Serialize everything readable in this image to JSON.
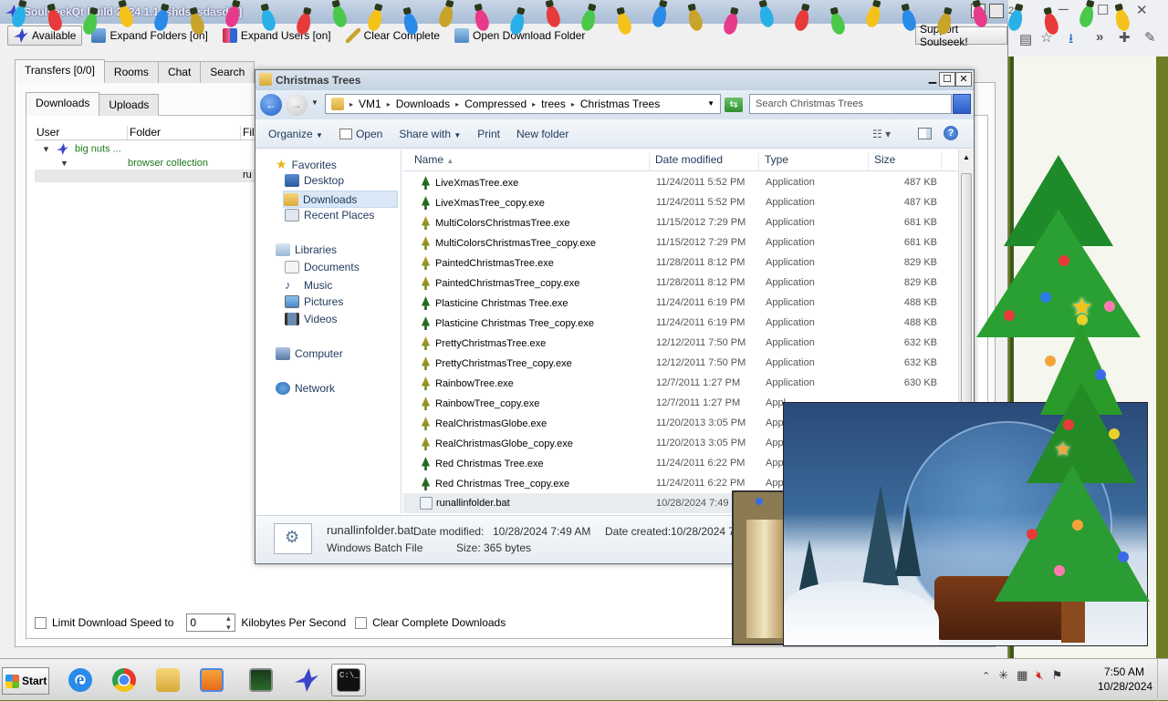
{
  "soulseek": {
    "title": "SoulseekQt build 2024.1.1 [shdsasdasdfs]",
    "toolbar": {
      "status": "Available",
      "expand_folders": "Expand Folders [on]",
      "expand_users": "Expand Users [on]",
      "clear_complete": "Clear Complete",
      "open_download_folder": "Open Download Folder",
      "support": "Support Soulseek!"
    },
    "tabs": [
      {
        "label": "Transfers [0/0]"
      },
      {
        "label": "Rooms"
      },
      {
        "label": "Chat"
      },
      {
        "label": "Search"
      }
    ],
    "subtabs": [
      {
        "label": "Downloads"
      },
      {
        "label": "Uploads"
      }
    ],
    "columns": {
      "user": "User",
      "folder": "Folder",
      "file": "Fil"
    },
    "tree": {
      "user": "big nuts ...",
      "folder": "browser collection",
      "file": "ru"
    },
    "bottom": {
      "limit_label": "Limit Download Speed to",
      "limit_value": "0",
      "unit": "Kilobytes Per Second",
      "clear_complete_downloads": "Clear Complete Downloads"
    }
  },
  "explorer": {
    "title": "Christmas Trees",
    "breadcrumb": [
      "VM1",
      "Downloads",
      "Compressed",
      "trees",
      "Christmas Trees"
    ],
    "search_placeholder": "Search Christmas Trees",
    "commands": {
      "organize": "Organize",
      "open": "Open",
      "share_with": "Share with",
      "print": "Print",
      "new_folder": "New folder"
    },
    "nav": {
      "favorites": "Favorites",
      "desktop": "Desktop",
      "downloads": "Downloads",
      "recent_places": "Recent Places",
      "libraries": "Libraries",
      "documents": "Documents",
      "music": "Music",
      "pictures": "Pictures",
      "videos": "Videos",
      "computer": "Computer",
      "network": "Network"
    },
    "columns": {
      "name": "Name",
      "date": "Date modified",
      "type": "Type",
      "size": "Size"
    },
    "files": [
      {
        "name": "LiveXmasTree.exe",
        "date": "11/24/2011 5:52 PM",
        "type": "Application",
        "size": "487 KB",
        "icon": "green-tree-icon"
      },
      {
        "name": "LiveXmasTree_copy.exe",
        "date": "11/24/2011 5:52 PM",
        "type": "Application",
        "size": "487 KB",
        "icon": "green-tree-icon"
      },
      {
        "name": "MultiColorsChristmasTree.exe",
        "date": "11/15/2012 7:29 PM",
        "type": "Application",
        "size": "681 KB",
        "icon": "gold-tree-icon"
      },
      {
        "name": "MultiColorsChristmasTree_copy.exe",
        "date": "11/15/2012 7:29 PM",
        "type": "Application",
        "size": "681 KB",
        "icon": "gold-tree-icon"
      },
      {
        "name": "PaintedChristmasTree.exe",
        "date": "11/28/2011 8:12 PM",
        "type": "Application",
        "size": "829 KB",
        "icon": "gold-tree-icon"
      },
      {
        "name": "PaintedChristmasTree_copy.exe",
        "date": "11/28/2011 8:12 PM",
        "type": "Application",
        "size": "829 KB",
        "icon": "gold-tree-icon"
      },
      {
        "name": "Plasticine Christmas Tree.exe",
        "date": "11/24/2011 6:19 PM",
        "type": "Application",
        "size": "488 KB",
        "icon": "green-tree-icon"
      },
      {
        "name": "Plasticine Christmas Tree_copy.exe",
        "date": "11/24/2011 6:19 PM",
        "type": "Application",
        "size": "488 KB",
        "icon": "green-tree-icon"
      },
      {
        "name": "PrettyChristmasTree.exe",
        "date": "12/12/2011 7:50 PM",
        "type": "Application",
        "size": "632 KB",
        "icon": "gold-tree-icon"
      },
      {
        "name": "PrettyChristmasTree_copy.exe",
        "date": "12/12/2011 7:50 PM",
        "type": "Application",
        "size": "632 KB",
        "icon": "gold-tree-icon"
      },
      {
        "name": "RainbowTree.exe",
        "date": "12/7/2011 1:27 PM",
        "type": "Application",
        "size": "630 KB",
        "icon": "gold-tree-icon"
      },
      {
        "name": "RainbowTree_copy.exe",
        "date": "12/7/2011 1:27 PM",
        "type": "Appl",
        "size": "",
        "icon": "gold-tree-icon"
      },
      {
        "name": "RealChristmasGlobe.exe",
        "date": "11/20/2013 3:05 PM",
        "type": "Appl",
        "size": "",
        "icon": "gold-tree-icon"
      },
      {
        "name": "RealChristmasGlobe_copy.exe",
        "date": "11/20/2013 3:05 PM",
        "type": "Appl",
        "size": "",
        "icon": "gold-tree-icon"
      },
      {
        "name": "Red Christmas Tree.exe",
        "date": "11/24/2011 6:22 PM",
        "type": "Appl",
        "size": "",
        "icon": "green-tree-icon"
      },
      {
        "name": "Red Christmas Tree_copy.exe",
        "date": "11/24/2011 6:22 PM",
        "type": "Appl",
        "size": "",
        "icon": "green-tree-icon"
      },
      {
        "name": "runallinfolder.bat",
        "date": "10/28/2024 7:49",
        "type": "",
        "size": "",
        "icon": "batch-file-icon",
        "selected": true
      }
    ],
    "details": {
      "name": "runallinfolder.bat",
      "date_modified_label": "Date modified:",
      "date_modified": "10/28/2024 7:49 AM",
      "date_created_label": "Date created:",
      "date_created": "10/28/2024 7:",
      "type": "Windows Batch File",
      "size_label": "Size:",
      "size": "365 bytes"
    }
  },
  "taskbar": {
    "start": "Start",
    "apps": [
      "internet-explorer",
      "chrome",
      "file-explorer",
      "media-player",
      "task-manager",
      "soulseek",
      "command-prompt"
    ],
    "clock_time": "7:50 AM",
    "clock_date": "10/28/2024"
  },
  "browser_fragment": {
    "tab_text": "28"
  },
  "colors": {
    "accent": "#1e395b",
    "selection": "#e9ecef",
    "desktop": "#6d7a2a"
  }
}
